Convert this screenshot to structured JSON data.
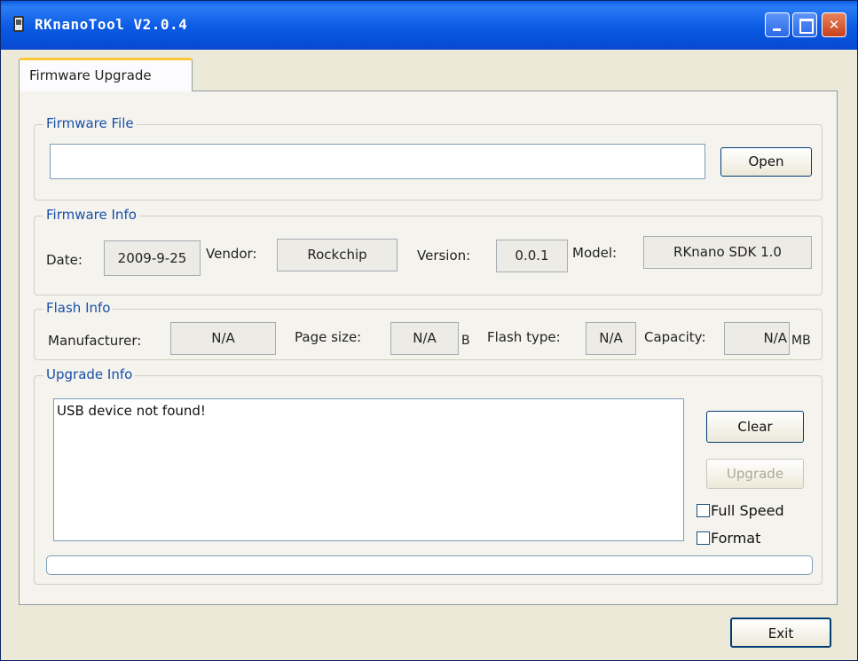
{
  "window": {
    "title": "RKnanoTool V2.0.4"
  },
  "tabs": [
    {
      "label": "Firmware Upgrade",
      "active": true
    }
  ],
  "firmware_file": {
    "legend": "Firmware File",
    "path_value": "",
    "open_label": "Open"
  },
  "firmware_info": {
    "legend": "Firmware Info",
    "date_label": "Date:",
    "date_value": "2009-9-25",
    "vendor_label": "Vendor:",
    "vendor_value": "Rockchip",
    "version_label": "Version:",
    "version_value": "0.0.1",
    "model_label": "Model:",
    "model_value": "RKnano SDK 1.0"
  },
  "flash_info": {
    "legend": "Flash Info",
    "manufacturer_label": "Manufacturer:",
    "manufacturer_value": "N/A",
    "page_size_label": "Page size:",
    "page_size_value": "N/A",
    "page_size_unit": "B",
    "flash_type_label": "Flash type:",
    "flash_type_value": "N/A",
    "capacity_label": "Capacity:",
    "capacity_value": "N/A",
    "capacity_unit": "MB"
  },
  "upgrade_info": {
    "legend": "Upgrade Info",
    "log_text": "USB device not found!",
    "clear_label": "Clear",
    "upgrade_label": "Upgrade",
    "full_speed_label": "Full Speed",
    "full_speed_checked": false,
    "format_label": "Format",
    "format_checked": false,
    "progress_percent": 0
  },
  "footer": {
    "exit_label": "Exit"
  },
  "colors": {
    "titlebar": "#0a5ae3",
    "legend_text": "#1a4fa8",
    "tab_highlight": "#ffc83c",
    "window_bg": "#ece9d8"
  }
}
